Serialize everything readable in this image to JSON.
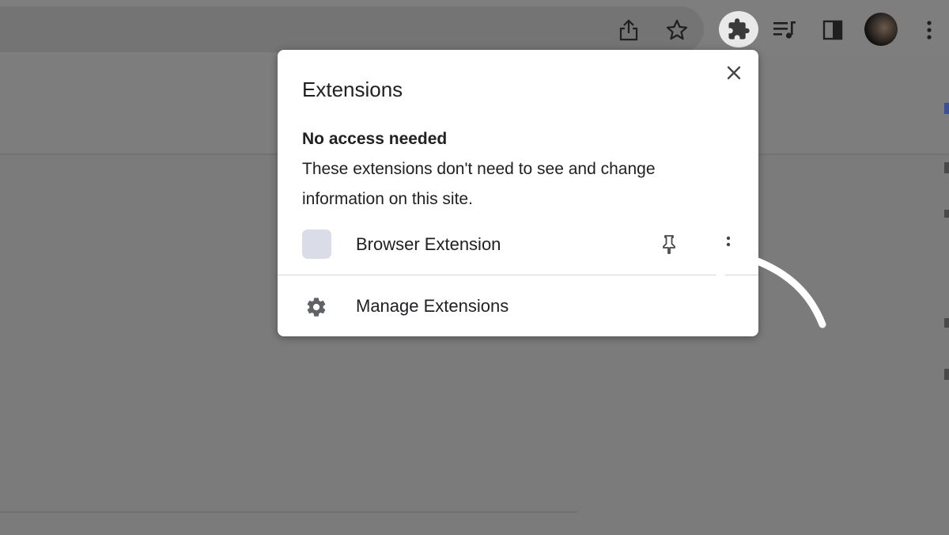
{
  "toolbar": {
    "icons": [
      "share-icon",
      "bookmark-star-icon",
      "extensions-puzzle-icon",
      "reading-list-icon",
      "side-panel-icon",
      "profile-avatar",
      "more-menu-icon"
    ]
  },
  "popup": {
    "title": "Extensions",
    "close_icon": "close-icon",
    "section_heading": "No access needed",
    "section_description": "These extensions don't need to see and change information on this site.",
    "extension": {
      "name": "Browser Extension",
      "pin_icon": "pin-icon",
      "more_icon": "more-vert-icon"
    },
    "manage": {
      "label": "Manage Extensions",
      "icon": "gear-icon"
    }
  },
  "annotation": {
    "arrow": "curved-arrow-pointing-to-pin"
  },
  "colors": {
    "overlay_gray": "#7b7b7b",
    "popup_background": "#ffffff",
    "text": "#202124",
    "extension_icon_placeholder": "#dadce8"
  }
}
